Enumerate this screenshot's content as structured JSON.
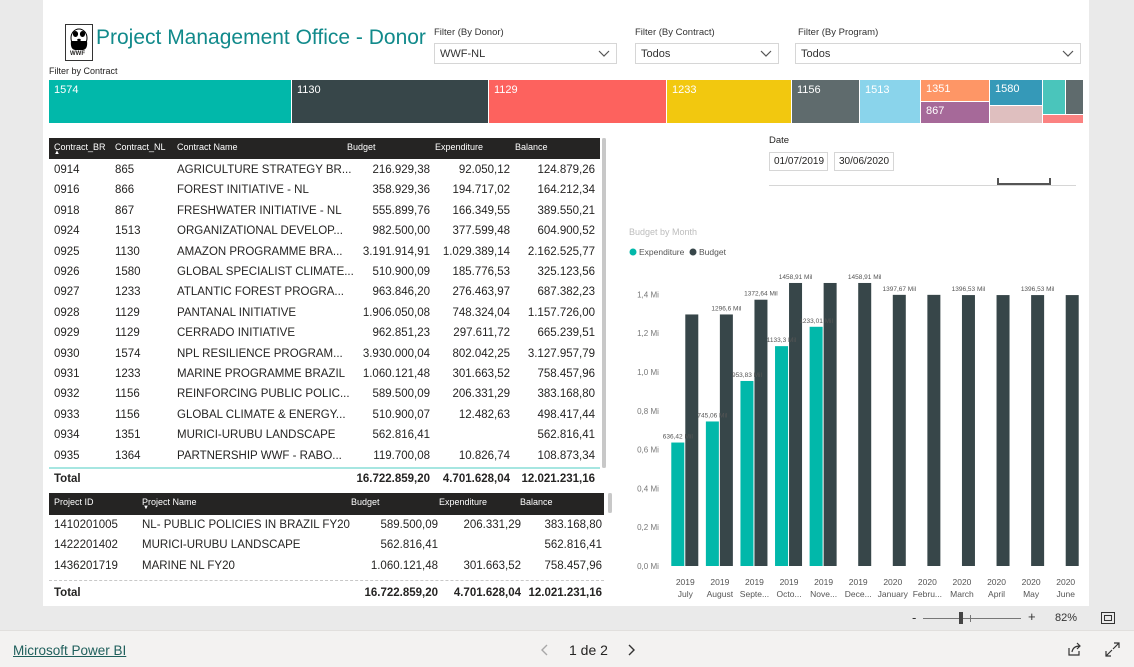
{
  "report": {
    "title": "Project Management Office - Donor",
    "logo_text": "WWF",
    "filter_by_contract_label": "Filter by Contract"
  },
  "filters": {
    "donor": {
      "label": "Filter (By Donor)",
      "value": "WWF-NL"
    },
    "contract": {
      "label": "Filter (By Contract)",
      "value": "Todos"
    },
    "program": {
      "label": "Filter (By Program)",
      "value": "Todos"
    }
  },
  "treemap": {
    "tiles": [
      {
        "label": "1574",
        "color": "#01b8aa"
      },
      {
        "label": "1130",
        "color": "#374649"
      },
      {
        "label": "1129",
        "color": "#fd625e"
      },
      {
        "label": "1233",
        "color": "#f2c80f"
      },
      {
        "label": "1156",
        "color": "#5f6b6d"
      },
      {
        "label": "1513",
        "color": "#8ad4eb"
      },
      {
        "label": "1351",
        "color": "#fe9666"
      },
      {
        "label": "867",
        "color": "#a66999"
      },
      {
        "label": "1580",
        "color": "#3599b8"
      },
      {
        "label": "",
        "color": "#dfbfbf"
      },
      {
        "label": "",
        "color": "#4ac5bb"
      },
      {
        "label": "",
        "color": "#5f6b6d"
      },
      {
        "label": "",
        "color": "#fb8281"
      }
    ]
  },
  "contracts_table": {
    "headers": [
      "Contract_BR",
      "Contract_NL",
      "Contract Name",
      "Budget",
      "Expenditure",
      "Balance"
    ],
    "rows": [
      [
        "0914",
        "865",
        "AGRICULTURE STRATEGY BR...",
        "216.929,38",
        "92.050,12",
        "124.879,26"
      ],
      [
        "0916",
        "866",
        "FOREST INITIATIVE - NL",
        "358.929,36",
        "194.717,02",
        "164.212,34"
      ],
      [
        "0918",
        "867",
        "FRESHWATER INITIATIVE - NL",
        "555.899,76",
        "166.349,55",
        "389.550,21"
      ],
      [
        "0924",
        "1513",
        "ORGANIZATIONAL DEVELOP...",
        "982.500,00",
        "377.599,48",
        "604.900,52"
      ],
      [
        "0925",
        "1130",
        "AMAZON PROGRAMME BRA...",
        "3.191.914,91",
        "1.029.389,14",
        "2.162.525,77"
      ],
      [
        "0926",
        "1580",
        "GLOBAL SPECIALIST CLIMATE...",
        "510.900,09",
        "185.776,53",
        "325.123,56"
      ],
      [
        "0927",
        "1233",
        "ATLANTIC FOREST PROGRA...",
        "963.846,20",
        "276.463,97",
        "687.382,23"
      ],
      [
        "0928",
        "1129",
        "PANTANAL INITIATIVE",
        "1.906.050,08",
        "748.324,04",
        "1.157.726,00"
      ],
      [
        "0929",
        "1129",
        "CERRADO INITIATIVE",
        "962.851,23",
        "297.611,72",
        "665.239,51"
      ],
      [
        "0930",
        "1574",
        "NPL RESILIENCE PROGRAM...",
        "3.930.000,04",
        "802.042,25",
        "3.127.957,79"
      ],
      [
        "0931",
        "1233",
        "MARINE PROGRAMME BRAZIL",
        "1.060.121,48",
        "301.663,52",
        "758.457,96"
      ],
      [
        "0932",
        "1156",
        "REINFORCING PUBLIC POLIC...",
        "589.500,09",
        "206.331,29",
        "383.168,80"
      ],
      [
        "0933",
        "1156",
        "GLOBAL CLIMATE & ENERGY...",
        "510.900,07",
        "12.482,63",
        "498.417,44"
      ],
      [
        "0934",
        "1351",
        "MURICI-URUBU LANDSCAPE",
        "562.816,41",
        "",
        "562.816,41"
      ],
      [
        "0935",
        "1364",
        "PARTNERSHIP WWF -  RABO...",
        "119.700,08",
        "10.826,74",
        "108.873,34"
      ]
    ],
    "total": {
      "label": "Total",
      "budget": "16.722.859,20",
      "expenditure": "4.701.628,04",
      "balance": "12.021.231,16"
    }
  },
  "projects_table": {
    "headers": [
      "Project ID",
      "Project Name",
      "Budget",
      "Expenditure",
      "Balance"
    ],
    "rows": [
      [
        "1410201005",
        "NL- PUBLIC POLICIES IN BRAZIL FY20",
        "589.500,09",
        "206.331,29",
        "383.168,80"
      ],
      [
        "1422201402",
        "MURICI-URUBU LANDSCAPE",
        "562.816,41",
        "",
        "562.816,41"
      ],
      [
        "1436201719",
        "MARINE NL FY20",
        "1.060.121,48",
        "301.663,52",
        "758.457,96"
      ]
    ],
    "total": {
      "label": "Total",
      "budget": "16.722.859,20",
      "expenditure": "4.701.628,04",
      "balance": "12.021.231,16"
    }
  },
  "date_slicer": {
    "label": "Date",
    "start": "01/07/2019",
    "end": "30/06/2020"
  },
  "chart_data": {
    "type": "bar",
    "title": "Budget by Month",
    "legend_position": "top-left",
    "categories": [
      [
        "2019",
        "July"
      ],
      [
        "2019",
        "August"
      ],
      [
        "2019",
        "Septe..."
      ],
      [
        "2019",
        "Octo..."
      ],
      [
        "2019",
        "Nove..."
      ],
      [
        "2019",
        "Dece..."
      ],
      [
        "2020",
        "January"
      ],
      [
        "2020",
        "Febru..."
      ],
      [
        "2020",
        "March"
      ],
      [
        "2020",
        "April"
      ],
      [
        "2020",
        "May"
      ],
      [
        "2020",
        "June"
      ]
    ],
    "series": [
      {
        "name": "Expenditure",
        "color": "#01b8aa",
        "values": [
          0.63642,
          0.745,
          0.9538,
          1.1333,
          1.23301,
          null,
          null,
          null,
          null,
          null,
          null,
          null
        ],
        "labels": [
          "636,42 Mil",
          "745,06 Mil",
          "953,83 Mil",
          "1133,3 Mil",
          "1233,01 Mil",
          "",
          "",
          "",
          "",
          "",
          "",
          ""
        ]
      },
      {
        "name": "Budget",
        "color": "#374649",
        "values": [
          1.2966,
          1.2966,
          1.37264,
          1.45891,
          1.45891,
          1.45891,
          1.39767,
          1.39767,
          1.39653,
          1.39653,
          1.39653,
          1.39653
        ],
        "labels": [
          "",
          "1296,6 Mil",
          "1372,64 Mil",
          "1458,91 Mil",
          "",
          "1458,91 Mil",
          "1397,67 Mil",
          "",
          "1396,53 Mil",
          "",
          "1396,53 Mil",
          ""
        ]
      }
    ],
    "y_ticks": [
      "0,0 Mi",
      "0,2 Mi",
      "0,4 Mi",
      "0,6 Mi",
      "0,8 Mi",
      "1,0 Mi",
      "1,2 Mi",
      "1,4 Mi"
    ],
    "ylim": [
      0,
      1.5
    ],
    "grid": false
  },
  "zoom": {
    "level": "82%",
    "minus": "-",
    "plus": "+"
  },
  "footer": {
    "brand": "Microsoft Power BI",
    "page_indicator": "1 de 2"
  }
}
